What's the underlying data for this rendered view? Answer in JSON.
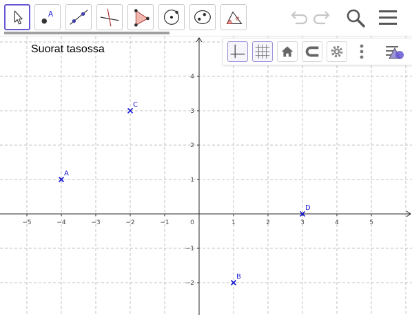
{
  "toolbar": {
    "tools": [
      {
        "name": "move",
        "icon": "cursor-arrow-icon",
        "active": true
      },
      {
        "name": "point",
        "icon": "point-icon",
        "label": "A"
      },
      {
        "name": "line",
        "icon": "line-through-points-icon"
      },
      {
        "name": "perpendicular-line",
        "icon": "perpendicular-line-icon"
      },
      {
        "name": "polygon",
        "icon": "polygon-icon"
      },
      {
        "name": "circle",
        "icon": "circle-center-point-icon"
      },
      {
        "name": "ellipse",
        "icon": "ellipse-icon"
      },
      {
        "name": "angle",
        "icon": "angle-icon",
        "label": "α"
      }
    ],
    "right": [
      {
        "name": "undo",
        "icon": "undo-icon"
      },
      {
        "name": "redo",
        "icon": "redo-icon"
      },
      {
        "name": "search",
        "icon": "search-icon"
      },
      {
        "name": "menu",
        "icon": "hamburger-menu-icon"
      }
    ]
  },
  "graphics_style_bar": {
    "buttons": [
      "axes-toggle-icon",
      "grid-toggle-icon",
      "home-view-icon",
      "point-capturing-icon",
      "settings-gear-icon",
      "more-options-icon",
      "toggle-style-bar-icon"
    ]
  },
  "view": {
    "title": "Suorat tasossa",
    "x_ticks": [
      "−5",
      "−4",
      "−3",
      "−2",
      "−1",
      "1",
      "2",
      "3",
      "4",
      "5"
    ],
    "y_ticks": [
      "4",
      "3",
      "2",
      "1",
      "−1",
      "−2"
    ],
    "origin_label": "0",
    "grid": true,
    "grid_style": "dashed",
    "colors": {
      "axis": "#252525",
      "grid": "#c0c0c0",
      "point": "#1a1ad6"
    }
  },
  "points": [
    {
      "label": "A",
      "x": -4,
      "y": 1
    },
    {
      "label": "C",
      "x": -2,
      "y": 3
    },
    {
      "label": "D",
      "x": 3,
      "y": 0
    },
    {
      "label": "B",
      "x": 1,
      "y": -2
    }
  ]
}
